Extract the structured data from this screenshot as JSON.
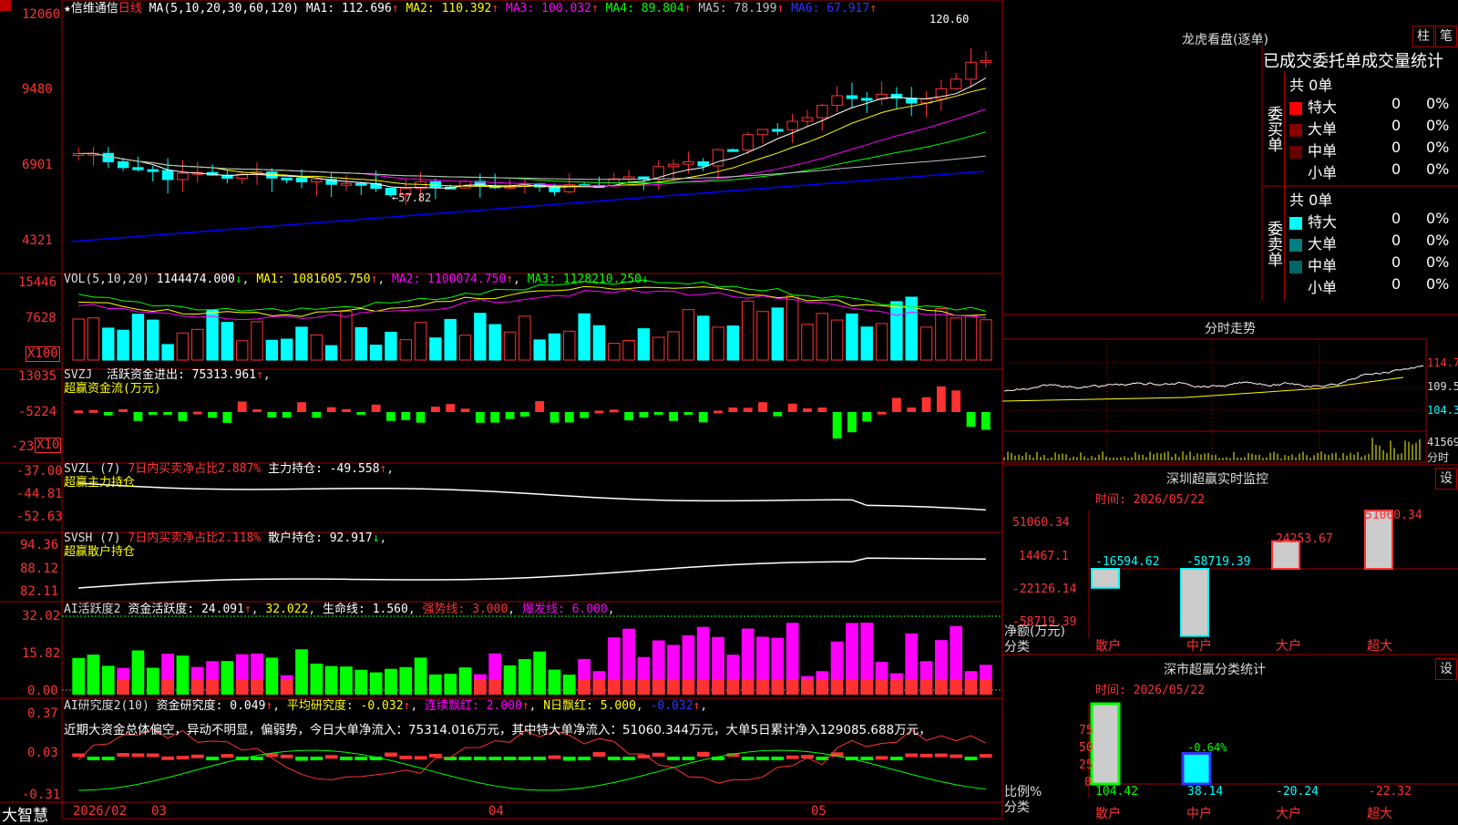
{
  "colors": {
    "up": "#ff3232",
    "down": "#00ffff",
    "ma1": "#ffffff",
    "ma2": "#ffff00",
    "ma3": "#ff00ff",
    "ma4": "#00ff00",
    "ma5": "#c0c0c0",
    "ma6": "#0000ff",
    "grid": "#a00000",
    "magenta": "#ff00ff",
    "green": "#00ff00",
    "yellow": "#ffff00"
  },
  "header": {
    "title": "★信维通信",
    "period": "日线",
    "ma_label": "MA(5,10,20,30,60,120)",
    "ma1": "MA1: 112.696",
    "ma2": "MA2: 110.392",
    "ma3": "MA3: 100.032",
    "ma4": "MA4: 89.804",
    "ma5": "MA5: 78.199",
    "ma6": "MA6: 67.917",
    "arrow": "↑",
    "high_mark": "120.60",
    "low_mark": "57.82"
  },
  "price_axis": [
    "12060",
    "9480",
    "6901",
    "4321"
  ],
  "vol": {
    "label": "VOL(5,10,20)",
    "value": "1144474.000",
    "arrow_down": "↓",
    "ma1": "MA1: 1081605.750",
    "ma2": "MA2: 1100074.750",
    "ma3": "MA3: 1128210.250",
    "axis": [
      "15446",
      "7628"
    ],
    "unit": "X100"
  },
  "svzj": {
    "label": "SVZJ",
    "desc": "活跃资金进出: 75313.961",
    "sub": "超赢资金流(万元)",
    "axis": [
      "13035",
      "-5224",
      "-23"
    ],
    "unit": "X10"
  },
  "svzl": {
    "label": "SVZL (7)",
    "desc1": "7日内买卖净占比2.887%",
    "desc2": "主力持仓: -49.558",
    "sub": "超赢主力持仓",
    "axis": [
      "-37.00",
      "-44.81",
      "-52.63"
    ]
  },
  "svsh": {
    "label": "SVSH (7)",
    "desc1": "7日内买卖净占比2.118%",
    "desc2": "散户持仓: 92.917",
    "sub": "超赢散户持仓",
    "axis": [
      "94.36",
      "88.12",
      "82.11"
    ]
  },
  "ai2": {
    "label": "AI活跃度2",
    "desc": "资金活跃度: 24.091",
    "v2": "32.022",
    "life": "生命线: 1.560",
    "strong": "强势线: 3.000",
    "burst": "爆发线: 6.000",
    "axis": [
      "32.02",
      "15.82",
      "0.00"
    ]
  },
  "ai_r": {
    "label": "AI研究度2(10)",
    "desc": "资金研究度: 0.049",
    "avg": "平均研究度: -0.032",
    "lian": "连续飘红: 2.000",
    "n": "N日飘红: 5.000",
    "neg": "-0.032",
    "comment": "近期大资金总体偏空，异动不明显，偏弱势，今日大单净流入：75314.016万元，其中特大单净流入：51060.344万元，大单5日累计净入129085.688万元，",
    "axis": [
      "0.37",
      "0.03",
      "-0.31"
    ]
  },
  "date_axis": {
    "brand": "大智慧",
    "labels": [
      "2026/02",
      "03",
      "04",
      "05"
    ]
  },
  "longhu": {
    "title": "龙虎看盘(逐单)",
    "btn1": "柱",
    "btn2": "笔",
    "tabs": "已成交委托单成交量统计",
    "buy": {
      "side": "委买单",
      "total": "共 0单",
      "rows": [
        {
          "name": "特大",
          "n": "0",
          "p": "0%",
          "color": "#ff0000"
        },
        {
          "name": "大单",
          "n": "0",
          "p": "0%",
          "color": "#880000"
        },
        {
          "name": "中单",
          "n": "0",
          "p": "0%",
          "color": "#660000"
        },
        {
          "name": "小单",
          "n": "0",
          "p": "0%",
          "color": "#000000"
        }
      ]
    },
    "sell": {
      "side": "委卖单",
      "total": "共 0单",
      "rows": [
        {
          "name": "特大",
          "n": "0",
          "p": "0%",
          "color": "#00ffff"
        },
        {
          "name": "大单",
          "n": "0",
          "p": "0%",
          "color": "#008080"
        },
        {
          "name": "中单",
          "n": "0",
          "p": "0%",
          "color": "#006666"
        },
        {
          "name": "小单",
          "n": "0",
          "p": "0%",
          "color": "#000000"
        }
      ]
    }
  },
  "fenshi": {
    "title": "分时走势",
    "axis": [
      "114.7",
      "109.5",
      "104.3",
      "41569"
    ],
    "unit": "分时"
  },
  "monitor": {
    "title": "深圳超赢实时监控",
    "btn": "设",
    "time": "时间: 2026/05/22",
    "axis": [
      "51060.34",
      "14467.1",
      "-22126.14",
      "-58719.39"
    ],
    "ylabel": "净额(万元)",
    "xlabel": "分类",
    "cats": [
      "散户",
      "中户",
      "大户",
      "超大"
    ],
    "values": [
      "-16594.62",
      "-58719.39",
      "24253.67",
      "51060.34"
    ]
  },
  "classify": {
    "title": "深市超赢分类统计",
    "btn": "设",
    "time": "时间: 2026/05/22",
    "axis": [
      "75",
      "50",
      "25",
      "0"
    ],
    "ylabel": "比例%",
    "xlabel": "分类",
    "cats": [
      "散户",
      "中户",
      "大户",
      "超大"
    ],
    "top_label": "-0.64%",
    "values": [
      "104.42",
      "38.14",
      "-20.24",
      "-22.32"
    ]
  },
  "chart_data": [
    {
      "type": "bar",
      "title": "深圳超赢实时监控",
      "categories": [
        "散户",
        "中户",
        "大户",
        "超大"
      ],
      "values": [
        -16594.62,
        -58719.39,
        24253.67,
        51060.34
      ],
      "ylabel": "净额(万元)",
      "xlabel": "分类",
      "ylim": [
        -58719.39,
        51060.34
      ]
    },
    {
      "type": "bar",
      "title": "深市超赢分类统计",
      "categories": [
        "散户",
        "中户",
        "大户",
        "超大"
      ],
      "values": [
        104.42,
        38.14,
        -20.24,
        -22.32
      ],
      "ylabel": "比例%",
      "xlabel": "分类",
      "ylim": [
        0,
        75
      ]
    }
  ]
}
